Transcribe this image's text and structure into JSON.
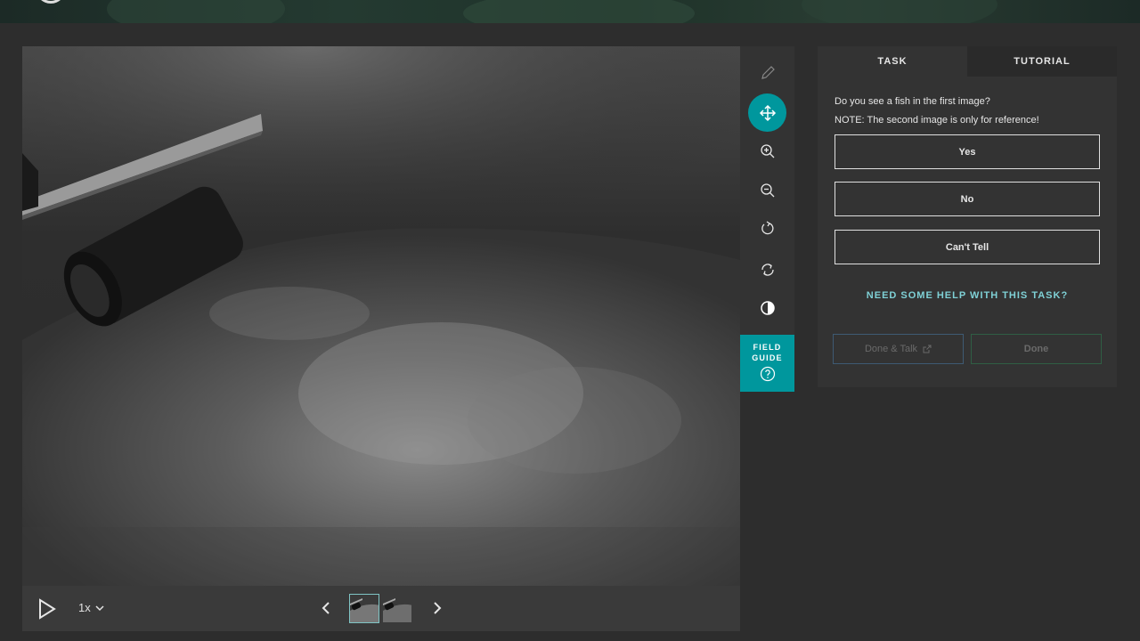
{
  "controls": {
    "speed_label": "1x"
  },
  "panel": {
    "tabs": [
      {
        "label": "TASK",
        "active": true
      },
      {
        "label": "TUTORIAL",
        "active": false
      }
    ],
    "question": "Do you see a fish in the first image?",
    "note": "NOTE: The second image is only for reference!",
    "answers": [
      "Yes",
      "No",
      "Can't Tell"
    ],
    "help_link": "NEED SOME HELP WITH THIS TASK?",
    "done_talk_label": "Done & Talk",
    "done_label": "Done"
  },
  "toolbar": {
    "tools": [
      "pencil-icon",
      "move-icon",
      "zoom-in-icon",
      "zoom-out-icon",
      "rotate-icon",
      "reset-icon",
      "invert-icon"
    ],
    "active_tool": "move-icon",
    "field_guide_label": "FIELD\nGUIDE"
  },
  "colors": {
    "accent": "#00979d",
    "background": "#2d2d2d",
    "panel": "#333333",
    "link": "#7fd1d6"
  }
}
